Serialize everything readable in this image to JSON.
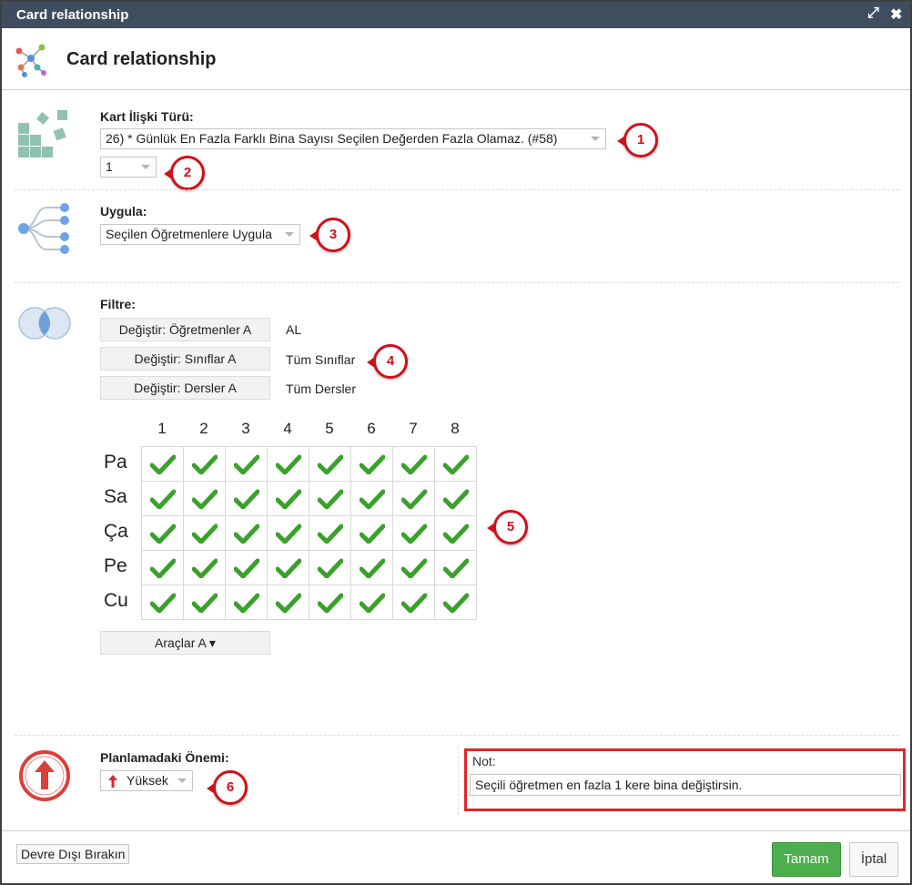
{
  "window": {
    "title": "Card relationship",
    "maximize_glyph": "⤢",
    "close_glyph": "✖"
  },
  "header": {
    "title": "Card relationship",
    "icon": "network-graph-icon"
  },
  "relation_type": {
    "label": "Kart İlişki Türü:",
    "selected": "26) * Günlük En Fazla Farklı Bina Sayısı Seçilen Değerden Fazla Olamaz. (#58)",
    "value_selected": "1",
    "icon": "blocks-icon"
  },
  "apply": {
    "label": "Uygula:",
    "selected": "Seçilen Öğretmenlere Uygula",
    "icon": "tree-branch-icon"
  },
  "filter": {
    "label": "Filtre:",
    "icon": "venn-icon",
    "rows": [
      {
        "button": "Değiştir: Öğretmenler A",
        "value": "AL"
      },
      {
        "button": "Değiştir: Sınıflar A",
        "value": "Tüm Sınıflar"
      },
      {
        "button": "Değiştir: Dersler A",
        "value": "Tüm Dersler"
      }
    ]
  },
  "timetable": {
    "periods": [
      "1",
      "2",
      "3",
      "4",
      "5",
      "6",
      "7",
      "8"
    ],
    "days": [
      "Pa",
      "Sa",
      "Ça",
      "Pe",
      "Cu"
    ],
    "cell_icon": "check-icon",
    "check_color": "#3aa12b"
  },
  "tools_button": "Araçlar A ▾",
  "importance": {
    "label": "Planlamadaki Önemi:",
    "selected": "Yüksek",
    "icon": "arrow-up-circle-icon",
    "color": "#d9403a"
  },
  "note": {
    "label": "Not:",
    "value": "Seçili öğretmen en fazla 1 kere bina değiştirsin."
  },
  "badges": [
    "1",
    "2",
    "3",
    "4",
    "5",
    "6"
  ],
  "footer": {
    "disable": "Devre Dışı Bırakın",
    "ok": "Tamam",
    "cancel": "İptal"
  },
  "colors": {
    "titlebar": "#3e4e5e",
    "badge": "#d0101a",
    "ok_button": "#4cae4c",
    "note_border": "#e0262b"
  }
}
